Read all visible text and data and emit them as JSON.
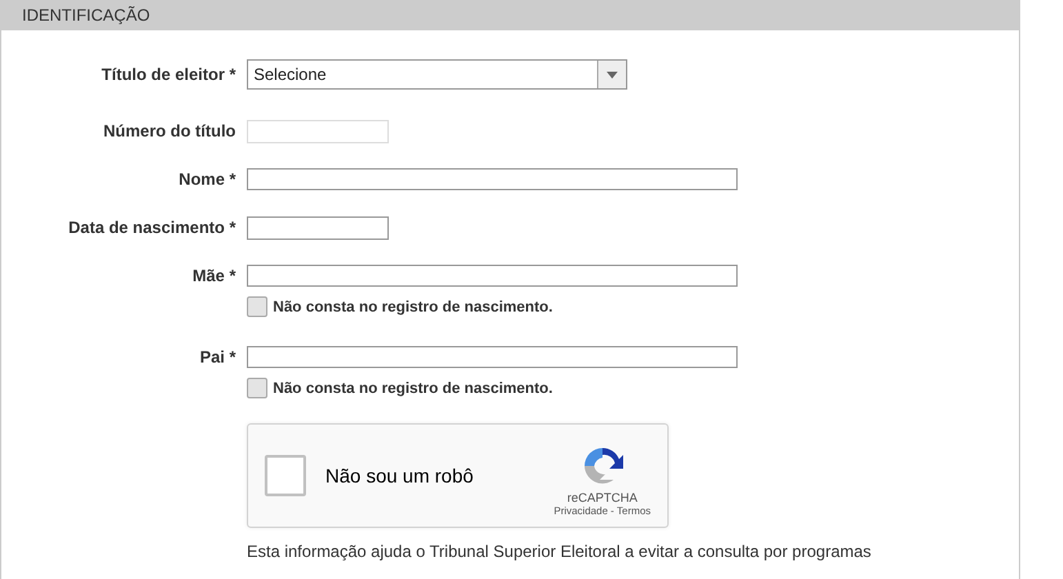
{
  "section": {
    "title": "IDENTIFICAÇÃO"
  },
  "fields": [
    {
      "kind": "select",
      "label": "Título de eleitor *",
      "value": "Selecione"
    },
    {
      "kind": "text",
      "label": "Número do título",
      "disabled": true
    },
    {
      "kind": "text",
      "label": "Nome *",
      "disabled": false
    },
    {
      "kind": "text",
      "label": "Data de nascimento *",
      "disabled": false
    },
    {
      "kind": "text",
      "label": "Mãe *",
      "disabled": false,
      "option": {
        "label": "Não consta no registro de nascimento.",
        "checked": false
      }
    },
    {
      "kind": "text",
      "label": "Pai *",
      "disabled": false,
      "option": {
        "label": "Não consta no registro de nascimento.",
        "checked": false
      }
    }
  ],
  "captcha": {
    "label": "Não sou um robô",
    "checked": false,
    "brand": "reCAPTCHA",
    "links": [
      "Privacidade",
      "Termos"
    ],
    "separator": "-"
  },
  "note": "Esta informação ajuda o Tribunal Superior Eleitoral a evitar a consulta por programas"
}
